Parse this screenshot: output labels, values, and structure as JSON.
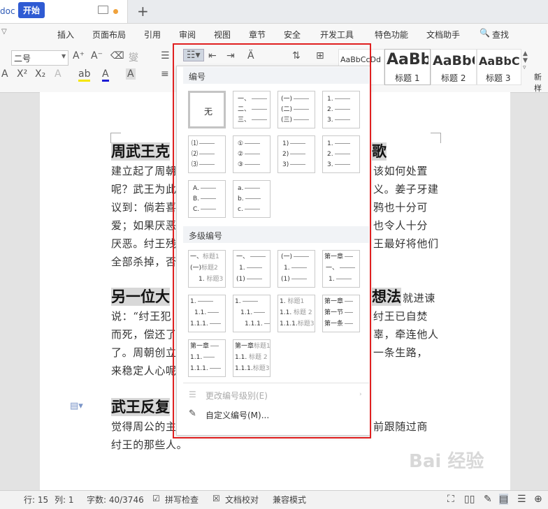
{
  "tab": {
    "title": "doc"
  },
  "menu": [
    "开始",
    "插入",
    "页面布局",
    "引用",
    "审阅",
    "视图",
    "章节",
    "安全",
    "开发工具",
    "特色功能",
    "文档助手",
    "查找"
  ],
  "ribbon": {
    "font_size": "二号",
    "styles": [
      {
        "sample": "AaBbCcDd",
        "label": ""
      },
      {
        "sample": "AaBb",
        "label": "标题 1"
      },
      {
        "sample": "AaBbC",
        "label": "标题 2"
      },
      {
        "sample": "AaBbCc",
        "label": "标题 3"
      }
    ],
    "new_style": "新样"
  },
  "document": {
    "h1": "周武王克",
    "h1_tail": "歌",
    "p1": [
      "建立起了周朝",
      "该如何处置",
      "呢？武王为此",
      "义。姜子牙建",
      "议到：倘若喜",
      "鸦也十分可",
      "爱；如果厌恶",
      "也令人十分",
      "厌恶。纣王残",
      "王最好将他们",
      "全部杀掉，否"
    ],
    "h2": "另一位大",
    "h2_tail": "想法",
    "h2_after": "就进谏",
    "p2": [
      "说：“纣王犯",
      "纣王已自焚",
      "而死，偿还了",
      "辜，牵连他人",
      "了。周朝创立",
      "一条生路，",
      "来稳定人心呢"
    ],
    "h3": "武王反复",
    "p3": [
      "觉得周公的主",
      "前跟随过商",
      "纣王的那些人。"
    ]
  },
  "dropdown": {
    "section1": "编号",
    "none_label": "无",
    "section2": "多级编号",
    "change_level": "更改编号级别(E)",
    "custom": "自定义编号(M)..."
  },
  "status": {
    "row": "行: 15",
    "col": "列: 1",
    "words": "字数: 40/3746",
    "spell": "拼写检查",
    "proof": "文档校对",
    "compat": "兼容模式"
  },
  "watermark": "Bai 经验"
}
